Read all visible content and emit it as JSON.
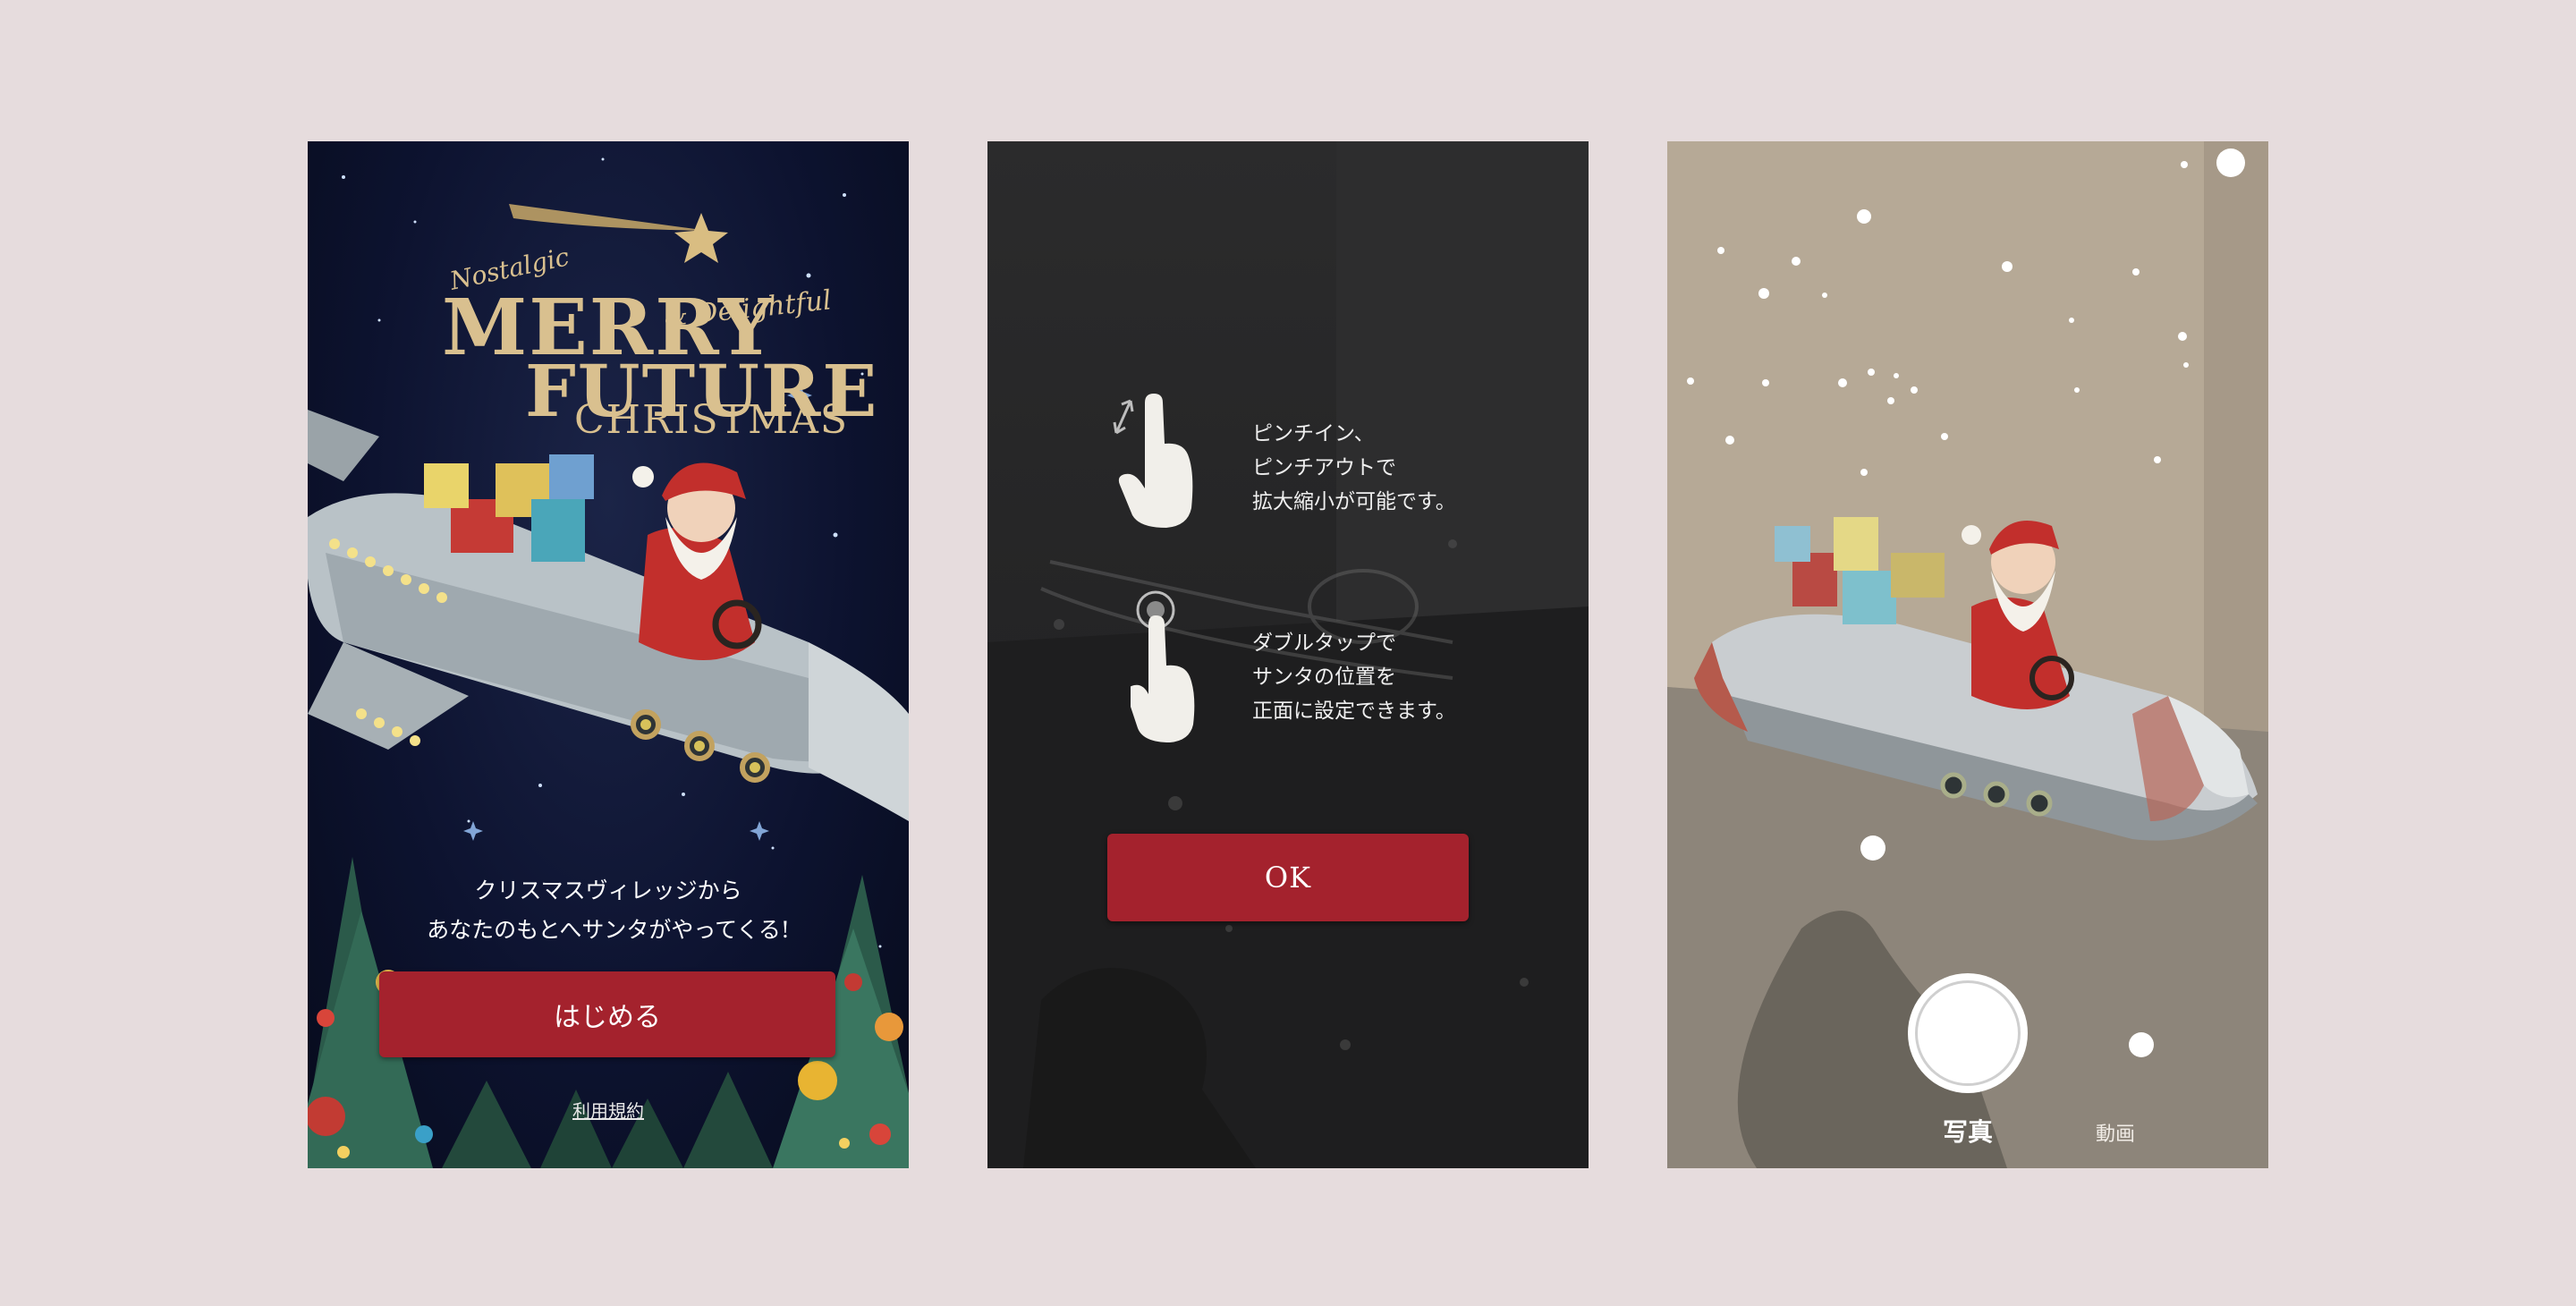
{
  "screens": [
    {
      "id": "title-screen",
      "logo": {
        "nostalgic": "Nostalgic",
        "merry": "MERRY",
        "delightful": "& Delightful",
        "future": "FUTURE",
        "christmas": "CHRISTMAS"
      },
      "tagline_line1": "クリスマスヴィレッジから",
      "tagline_line2": "あなたのもとへサンタがやってくる!",
      "start_button": "はじめる",
      "terms_link": "利用規約"
    },
    {
      "id": "instructions-screen",
      "pinch_hint": [
        "ピンチイン、",
        "ピンチアウトで",
        "拡大縮小が可能です。"
      ],
      "tap_hint": [
        "ダブルタップで",
        "サンタの位置を",
        "正面に設定できます。"
      ],
      "ok_button": "OK"
    },
    {
      "id": "camera-screen",
      "mode_photo": "写真",
      "mode_video": "動画"
    }
  ],
  "colors": {
    "background": "#e6dcdd",
    "button_red": "#a4222d",
    "night_sky": "#0d1330",
    "gold": "#d9c08f"
  },
  "icons": [
    "pinch-hand-icon",
    "double-tap-hand-icon",
    "shooting-star-icon",
    "shutter-button"
  ]
}
